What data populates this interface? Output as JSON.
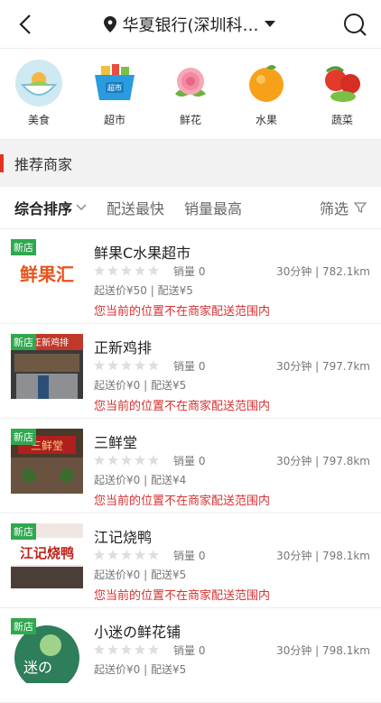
{
  "header": {
    "location_title": "华夏银行(深圳科…"
  },
  "categories": [
    {
      "label": "美食",
      "icon": "food-bowl-icon"
    },
    {
      "label": "超市",
      "icon": "supermarket-basket-icon"
    },
    {
      "label": "鲜花",
      "icon": "rose-flower-icon"
    },
    {
      "label": "水果",
      "icon": "orange-fruit-icon"
    },
    {
      "label": "蔬菜",
      "icon": "vegetables-icon"
    }
  ],
  "section": {
    "title": "推荐商家"
  },
  "sort": {
    "active_label": "综合排序",
    "fast_label": "配送最快",
    "sales_label": "销量最高",
    "filter_label": "筛选"
  },
  "colors": {
    "accent": "#e5331f",
    "new_tag": "#2fa84f",
    "warning": "#d93030"
  },
  "stores": [
    {
      "new_tag": "新店",
      "name": "鲜果C水果超市",
      "sales": "销量 0",
      "distance": "30分钟 | 782.1km",
      "fee": "起送价¥50 | 配送¥5",
      "warning": "您当前的位置不在商家配送范围内",
      "thumb_text": "鲜果汇"
    },
    {
      "new_tag": "新店",
      "name": "正新鸡排",
      "sales": "销量 0",
      "distance": "30分钟 | 797.7km",
      "fee": "起送价¥0 | 配送¥5",
      "warning": "您当前的位置不在商家配送范围内",
      "thumb_text": "正新鸡排"
    },
    {
      "new_tag": "新店",
      "name": "三鲜堂",
      "sales": "销量 0",
      "distance": "30分钟 | 797.8km",
      "fee": "起送价¥0 | 配送¥4",
      "warning": "您当前的位置不在商家配送范围内",
      "thumb_text": "三鲜堂"
    },
    {
      "new_tag": "新店",
      "name": "江记烧鸭",
      "sales": "销量 0",
      "distance": "30分钟 | 798.1km",
      "fee": "起送价¥0 | 配送¥5",
      "warning": "您当前的位置不在商家配送范围内",
      "thumb_text": "江记烧鸭"
    },
    {
      "new_tag": "新店",
      "name": "小迷の鲜花铺",
      "sales": "销量 0",
      "distance": "30分钟 | 798.1km",
      "fee": "起送价¥0 | 配送¥5",
      "warning": "",
      "thumb_text": "迷の"
    }
  ]
}
